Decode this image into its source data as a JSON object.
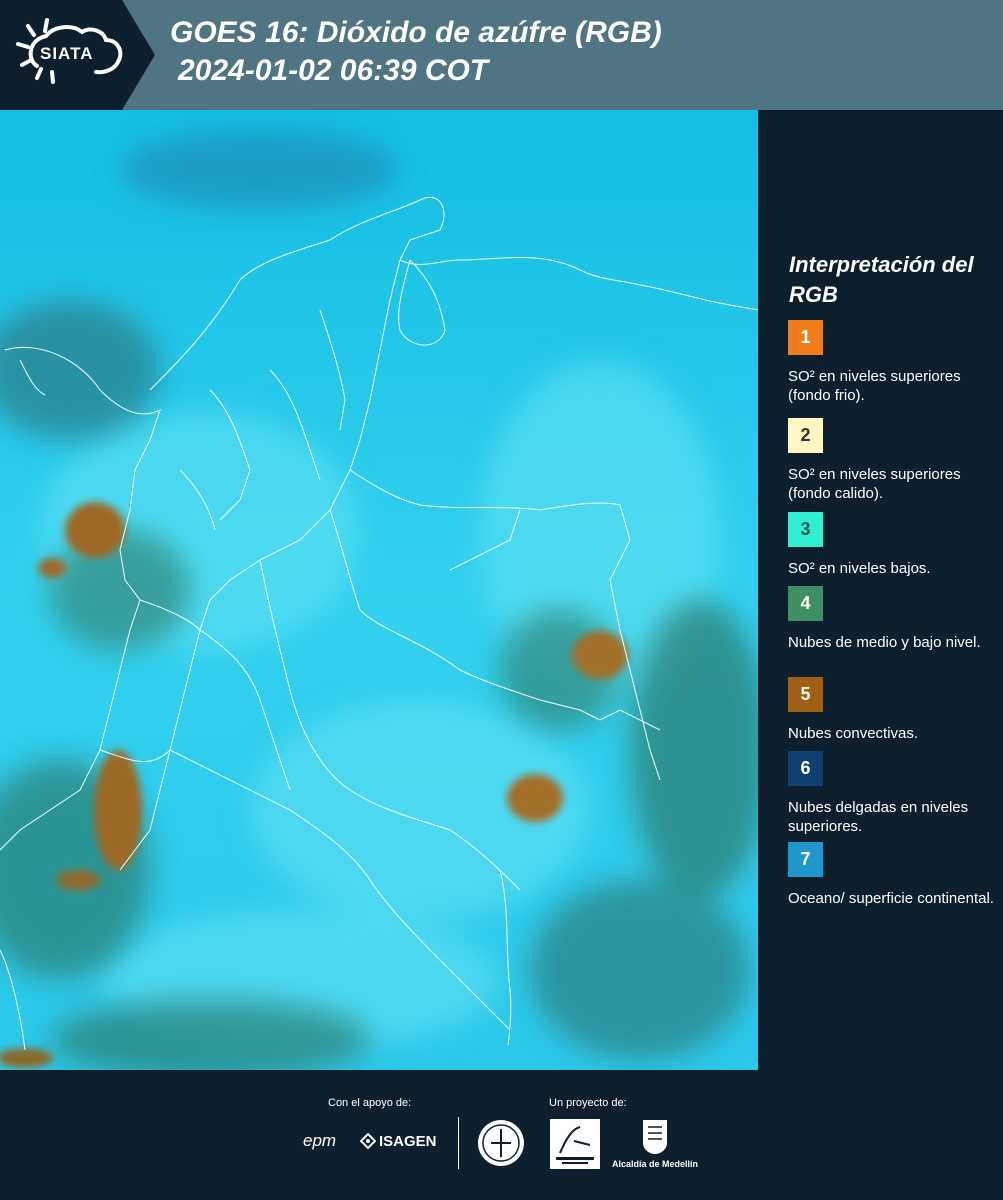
{
  "header": {
    "logo_text": "SIATA",
    "title_line1": "GOES 16: Dióxido de azúfre (RGB)",
    "title_line2": "2024-01-02 06:39 COT",
    "background": "#4f7482"
  },
  "map": {
    "background_color": "#2ecae9",
    "border_color": "#ffffff"
  },
  "legend": {
    "title": "Interpretación del RGB",
    "items": [
      {
        "number": "1",
        "color": "#f07d1a",
        "text": "SO² en niveles superiores (fondo frio)."
      },
      {
        "number": "2",
        "color": "#fff6c4",
        "text": "SO² en niveles superiores (fondo calido)."
      },
      {
        "number": "3",
        "color": "#2ef0cf",
        "text": "SO² en niveles bajos."
      },
      {
        "number": "4",
        "color": "#3f8f64",
        "text": "Nubes de medio y bajo nivel."
      },
      {
        "number": "5",
        "color": "#a05e14",
        "text": "Nubes convectivas."
      },
      {
        "number": "6",
        "color": "#0f3f6e",
        "text": "Nubes delgadas en niveles superiores."
      },
      {
        "number": "7",
        "color": "#1f97c8",
        "text": "Oceano/ superficie continental."
      }
    ]
  },
  "footer": {
    "support_label": "Con el apoyo de:",
    "project_label": "Un proyecto de:",
    "epm": "epm",
    "isagen": "ISAGEN",
    "alcaldia": "Alcaldía de Medellín"
  }
}
